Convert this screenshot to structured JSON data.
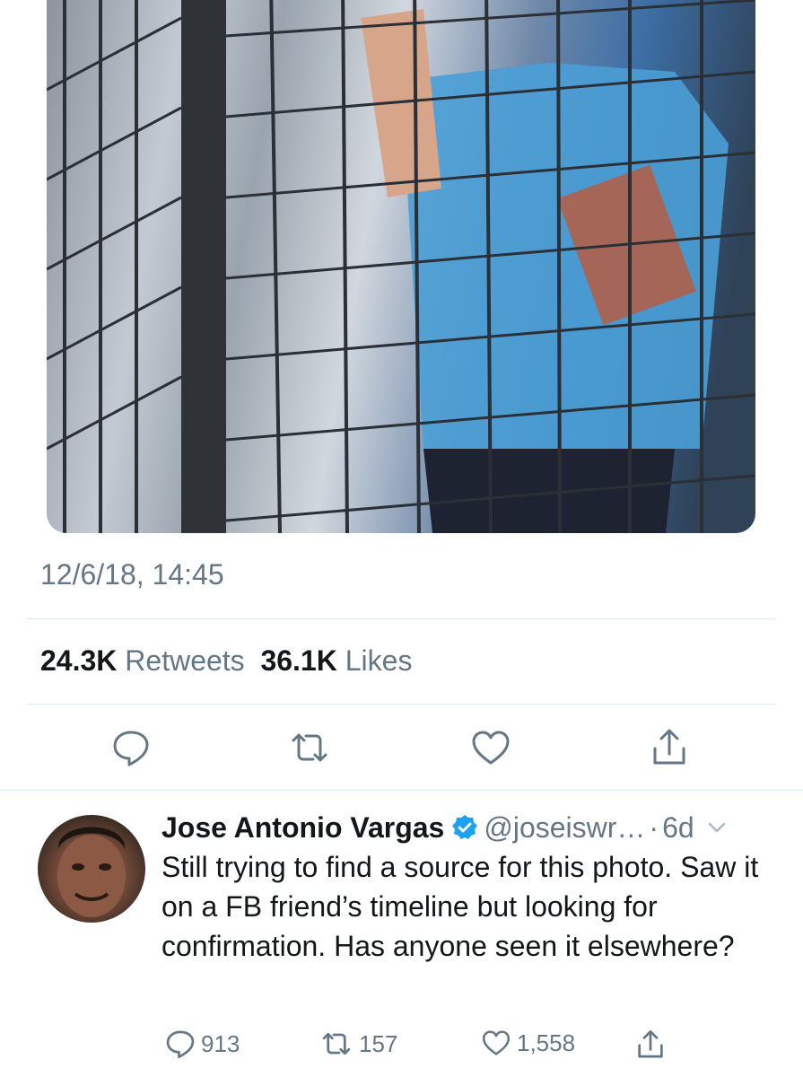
{
  "tweet": {
    "timestamp": "12/6/18, 14:45",
    "retweets_count": "24.3K",
    "retweets_label": "Retweets",
    "likes_count": "36.1K",
    "likes_label": "Likes"
  },
  "actions": {
    "reply_icon": "speech-bubble-icon",
    "retweet_icon": "retweet-icon",
    "like_icon": "heart-icon",
    "share_icon": "share-upload-icon"
  },
  "reply": {
    "name": "Jose Antonio Vargas",
    "handle": "@joseiswr…",
    "separator": "·",
    "time": "6d",
    "text": "Still trying to find a source for this photo. Saw it on a FB friend’s timeline but looking for confirmation. Has anyone seen it elsewhere?",
    "reply_count": "913",
    "retweet_count": "157",
    "like_count": "1,558"
  },
  "colors": {
    "accent": "#1da1f2",
    "muted": "#657786",
    "text": "#14171a",
    "divider": "#e1e8ed"
  }
}
